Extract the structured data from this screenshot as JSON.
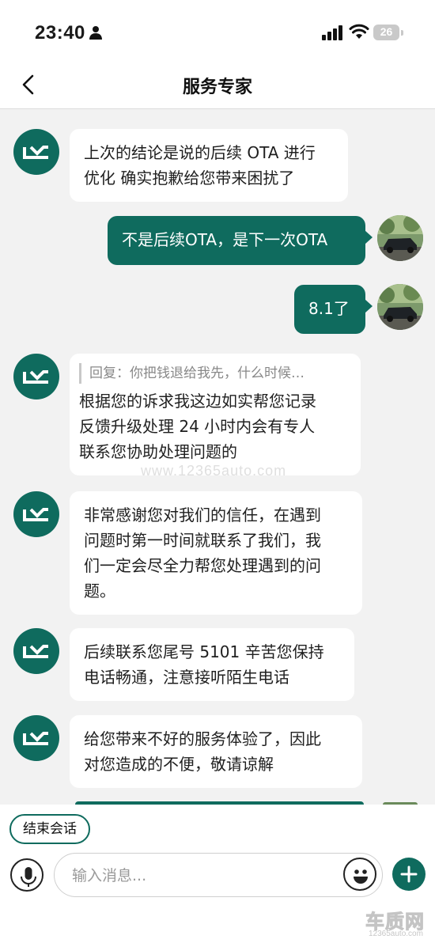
{
  "status_bar": {
    "time": "23:40",
    "battery": "26"
  },
  "header": {
    "title": "服务专家"
  },
  "messages": [
    {
      "side": "in",
      "text_lines": [
        "上次的结论是说的后续 OTA 进行",
        "优化 确实抱歉给您带来困扰了"
      ]
    },
    {
      "side": "out",
      "text": "不是后续OTA，是下一次OTA"
    },
    {
      "side": "out",
      "text": "8.1了"
    },
    {
      "side": "in",
      "reply_quote": "回复：你把钱退给我先，什么时候…",
      "text_lines": [
        "根据您的诉求我这边如实帮您记录",
        "反馈升级处理 24 小时内会有专人",
        "联系您协助处理问题的"
      ]
    },
    {
      "side": "in",
      "text_lines": [
        "非常感谢您对我们的信任，在遇到",
        "问题时第一时间就联系了我们，我",
        "们一定会尽全力帮您处理遇到的问",
        "题。"
      ]
    },
    {
      "side": "in",
      "text_lines": [
        "后续联系您尾号 5101 辛苦您保持",
        "电话畅通，注意接听陌生电话"
      ]
    },
    {
      "side": "in",
      "text_lines": [
        "给您带来不好的服务体验了，因此",
        "对您造成的不便，敬请谅解"
      ]
    }
  ],
  "watermark": "www.12365auto.com",
  "bottom": {
    "end_chat_label": "结束会话",
    "input_placeholder": "输入消息...",
    "logo_text": "车质网",
    "logo_url": "12365auto.com"
  },
  "colors": {
    "brand": "#0f6b5e",
    "background": "#f2f2f2"
  },
  "icons": [
    "person-icon",
    "signal-icon",
    "wifi-icon",
    "back-icon",
    "brand-logo-icon",
    "microphone-icon",
    "emoji-icon",
    "plus-icon"
  ]
}
